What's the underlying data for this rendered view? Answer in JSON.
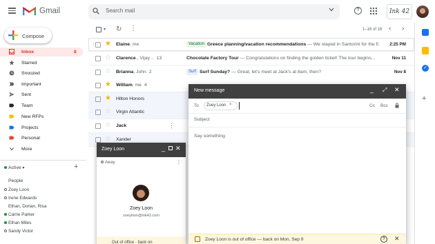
{
  "header": {
    "app_name": "Gmail",
    "search_placeholder": "Search mail",
    "help_glyph": "?",
    "brand_text": "Ink 42",
    "colors": {
      "gmail_red": "#ea4335",
      "blue": "#4285f4",
      "green": "#34a853",
      "yellow": "#fbbc04"
    }
  },
  "sidebar": {
    "compose_label": "Compose",
    "compose_glyph": "+",
    "items": [
      {
        "label": "Inbox",
        "count": "8",
        "icon": "inbox-icon",
        "active": true
      },
      {
        "label": "Starred",
        "count": "",
        "icon": "star-icon"
      },
      {
        "label": "Snoozed",
        "count": "",
        "icon": "clock-icon"
      },
      {
        "label": "Important",
        "count": "",
        "icon": "important-icon"
      },
      {
        "label": "Sent",
        "count": "",
        "icon": "send-icon"
      },
      {
        "label": "Team",
        "count": "",
        "icon": "label-icon",
        "color": "#202124"
      },
      {
        "label": "New RFPs",
        "count": "",
        "icon": "label-icon",
        "color": "#fbbc04"
      },
      {
        "label": "Projects",
        "count": "",
        "icon": "label-icon",
        "color": "#1a73e8"
      },
      {
        "label": "Personal",
        "count": "",
        "icon": "label-icon",
        "color": "#ea4335"
      },
      {
        "label": "More",
        "count": "",
        "icon": "chevron-down-icon"
      }
    ],
    "active_label": "Active",
    "active_caret": "▾",
    "add_glyph": "+",
    "people_label": "People",
    "people": [
      {
        "name": "Zoey Loon",
        "online": false
      },
      {
        "name": "Irene Edwards",
        "online": false
      },
      {
        "name": "Ethan, Dorian, Risa",
        "online": null
      },
      {
        "name": "Carrie Parker",
        "online": true
      },
      {
        "name": "Ethan Miles",
        "online": true
      },
      {
        "name": "Sandy Victor",
        "online": false
      }
    ]
  },
  "toolbar": {
    "caret": "▾",
    "refresh_glyph": "↻",
    "more_glyph": "⋮",
    "pagination": "1–16 of 16",
    "prev_glyph": "‹",
    "next_glyph": "›"
  },
  "emails": [
    {
      "sender": "Elaine",
      "suffix": ", me",
      "count": "",
      "tag": "Vacation",
      "tag_class": "tag-vac",
      "subject": "Greece planning/vacation recommendations",
      "snippet": " — We stayed in Santorini for the first...",
      "date": "2:25 PM",
      "starred": true,
      "unread": true
    },
    {
      "sender": "Clarence",
      "suffix": "., Vijay ..",
      "count": "13",
      "tag": "",
      "subject": "Chocolate Factory Tour",
      "snippet": " — Congratulations on finding the golden ticket! The tour begins...",
      "date": "Nov 11",
      "starred": false,
      "unread": true
    },
    {
      "sender": "Brianna",
      "suffix": ", John",
      "count": "2",
      "tag": "Surf",
      "tag_class": "tag-surf",
      "subject": "Surf Sunday?",
      "snippet": " — Great, let's meet at Jack's at 8am, then?",
      "date": "Nov 8",
      "starred": false,
      "unread": true
    },
    {
      "sender": "William",
      "suffix": ", me",
      "count": "4",
      "tag": "",
      "subject": "",
      "snippet": "",
      "date": "",
      "starred": true,
      "unread": true
    },
    {
      "sender": "Hilton Honors",
      "suffix": "",
      "count": "",
      "tag": "",
      "subject": "",
      "snippet": "",
      "date": "",
      "starred": true,
      "unread": false
    },
    {
      "sender": "Virgin Atlantic",
      "suffix": "",
      "count": "",
      "tag": "",
      "subject": "",
      "snippet": "",
      "date": "",
      "starred": false,
      "unread": false
    },
    {
      "sender": "Jack",
      "suffix": "",
      "count": "",
      "tag": "",
      "subject": "",
      "snippet": "",
      "date": "",
      "starred": false,
      "unread": true,
      "more": "⋮"
    },
    {
      "sender": "Xander",
      "suffix": "",
      "count": "",
      "tag": "",
      "subject": "",
      "snippet": "",
      "date": "",
      "starred": false,
      "unread": false
    }
  ],
  "drag_glyph": "⋮⋮",
  "side_panel": {
    "tasks_glyph": "✓",
    "add_glyph": "+"
  },
  "chat": {
    "title": "Zoey Loon",
    "min_glyph": "_",
    "close_glyph": "✕",
    "status": "Away",
    "more_glyph": "⋮",
    "name": "Zoey Loon",
    "email": "zoeyloon@ink42.com",
    "ooo_text": "Out of office · back on"
  },
  "compose": {
    "title": "New message",
    "min_glyph": "_",
    "expand_glyph": "⤢",
    "close_glyph": "✕",
    "to_label": "To",
    "recipient": "Zoey Loon",
    "chip_x": "×",
    "cc_label": "Cc",
    "bcc_label": "Bcc",
    "subject_placeholder": "Subject",
    "body_placeholder": "Say something",
    "ooo_text": "Zoey Loon is out of office — back on Mon, Sep 9",
    "ooo_help_glyph": "?",
    "ooo_close_glyph": "✕"
  }
}
